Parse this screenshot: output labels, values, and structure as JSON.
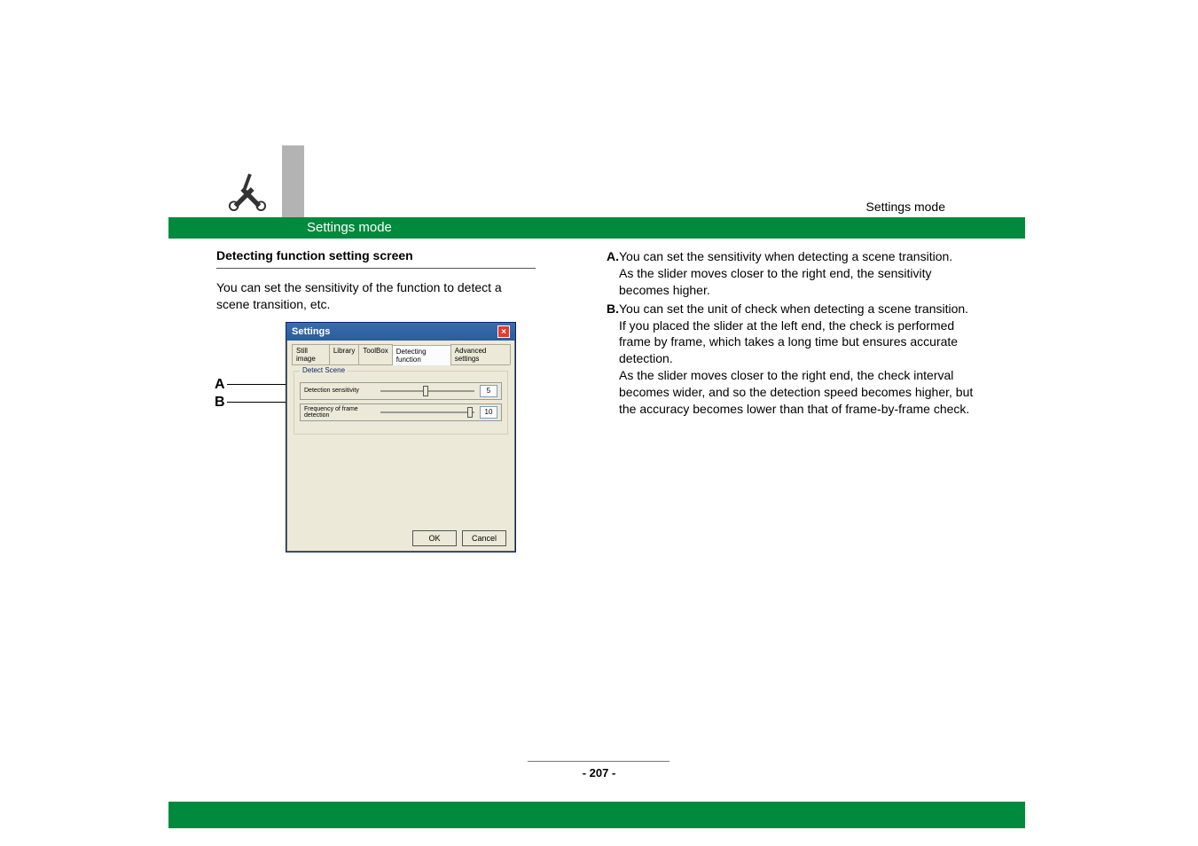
{
  "header": {
    "top_right_label": "Settings mode",
    "green_bar_text": "Settings mode"
  },
  "left": {
    "subhead": "Detecting function setting screen",
    "body": "You can set the sensitivity of the function to detect a scene transition, etc.",
    "callout_a": "A",
    "callout_b": "B"
  },
  "dialog": {
    "title": "Settings",
    "tabs": {
      "t1": "Still image",
      "t2": "Library",
      "t3": "ToolBox",
      "t4": "Detecting function",
      "t5": "Advanced settings"
    },
    "fieldset_legend": "Detect Scene",
    "row_a": {
      "label": "Detection sensitivity",
      "value": "5"
    },
    "row_b": {
      "label": "Frequency of frame detection",
      "value": "10"
    },
    "ok": "OK",
    "cancel": "Cancel"
  },
  "right": {
    "a_label": "A.",
    "a_text1": "You can set the sensitivity when detecting a scene transition.",
    "a_text2": "As the slider moves closer to the right end, the sensitivity becomes higher.",
    "b_label": "B.",
    "b_text1": "You can set the unit of check when detecting a scene transition.",
    "b_text2": "If you placed the slider at the left end, the check is performed frame by frame, which takes a long time but ensures accurate detection.",
    "b_text3": "As the slider moves closer to the right end, the check interval becomes wider, and so the detection speed becomes higher, but the accuracy becomes lower than that of frame-by-frame check."
  },
  "page_number": "- 207 -"
}
